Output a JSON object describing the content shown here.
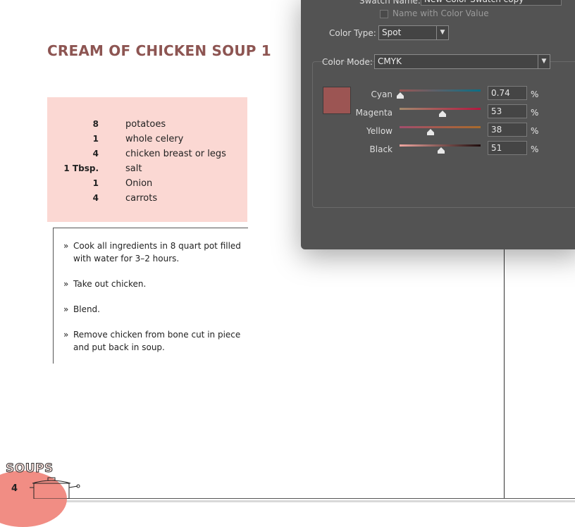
{
  "recipe": {
    "title": "CREAM OF CHICKEN SOUP 1",
    "ingredients": [
      {
        "qty": "8",
        "item": "potatoes"
      },
      {
        "qty": "1",
        "item": "whole celery"
      },
      {
        "qty": "4",
        "item": "chicken breast or legs"
      },
      {
        "qty": "1 Tbsp.",
        "item": "salt"
      },
      {
        "qty": "1",
        "item": "Onion"
      },
      {
        "qty": "4",
        "item": "carrots"
      }
    ],
    "steps": [
      {
        "bullet": "»",
        "text": "Cook all ingredients in 8 quart pot filled with water for 3–2 hours."
      },
      {
        "bullet": "»",
        "text": "Take out chicken."
      },
      {
        "bullet": "»",
        "text": "Blend."
      },
      {
        "bullet": "»",
        "text": "Remove chicken from bone cut in piece and put back in soup."
      }
    ]
  },
  "footer": {
    "section_label": "SOUPS",
    "page_number": "4"
  },
  "dialog": {
    "swatch_name_label": "Swatch Name:",
    "swatch_name_value": "New Color Swatch copy",
    "name_with_color_value_label": "Name with Color Value",
    "name_with_color_value_checked": false,
    "color_type_label": "Color Type:",
    "color_type_value": "Spot",
    "color_mode_label": "Color Mode:",
    "color_mode_value": "CMYK",
    "swatch_color": "#9c5553",
    "percent_sign": "%",
    "channels": [
      {
        "label": "Cyan",
        "value": "0.74",
        "level": 0.0074,
        "gradient": [
          "#9c5553",
          "#0b6f86"
        ]
      },
      {
        "label": "Magenta",
        "value": "53",
        "level": 0.53,
        "gradient": [
          "#a38a6e",
          "#b2183f"
        ]
      },
      {
        "label": "Yellow",
        "value": "38",
        "level": 0.38,
        "gradient": [
          "#a24d6c",
          "#a86b2c"
        ]
      },
      {
        "label": "Black",
        "value": "51",
        "level": 0.51,
        "gradient": [
          "#f0a6a0",
          "#1f0d0d"
        ]
      }
    ]
  }
}
